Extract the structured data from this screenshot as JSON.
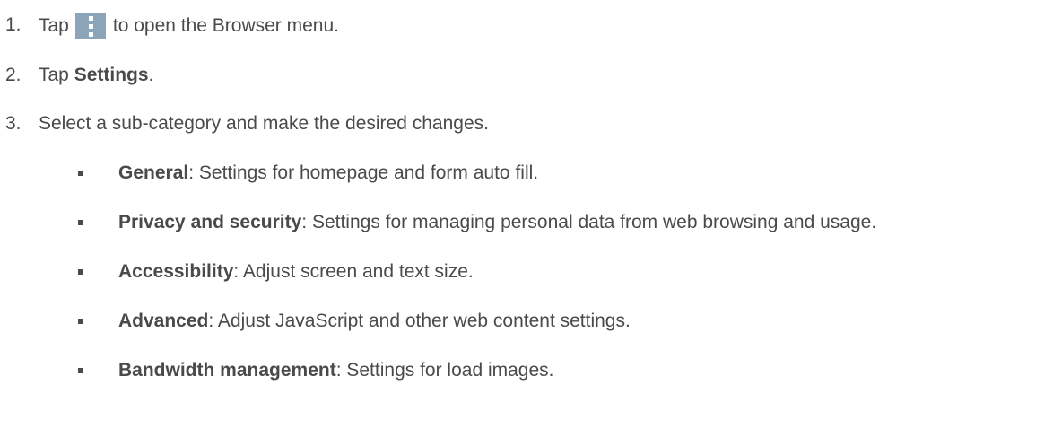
{
  "steps": [
    {
      "number": "1.",
      "before": "Tap",
      "icon": "overflow-menu-icon",
      "after": "to open the Browser menu."
    },
    {
      "number": "2.",
      "before": "Tap ",
      "bold": "Settings",
      "after": "."
    },
    {
      "number": "3.",
      "text": "Select a sub-category and make the desired changes."
    }
  ],
  "subcategories": [
    {
      "term": "General",
      "description": ": Settings for homepage and form auto fill."
    },
    {
      "term": "Privacy and security",
      "description": ": Settings for managing personal data from web browsing and usage."
    },
    {
      "term": "Accessibility",
      "description": ": Adjust screen and text size."
    },
    {
      "term": "Advanced",
      "description": ": Adjust JavaScript and other web content settings."
    },
    {
      "term": "Bandwidth management",
      "description": ": Settings for load images."
    }
  ],
  "colors": {
    "text": "#4a4a4a",
    "icon_background": "#8ba4b9"
  }
}
